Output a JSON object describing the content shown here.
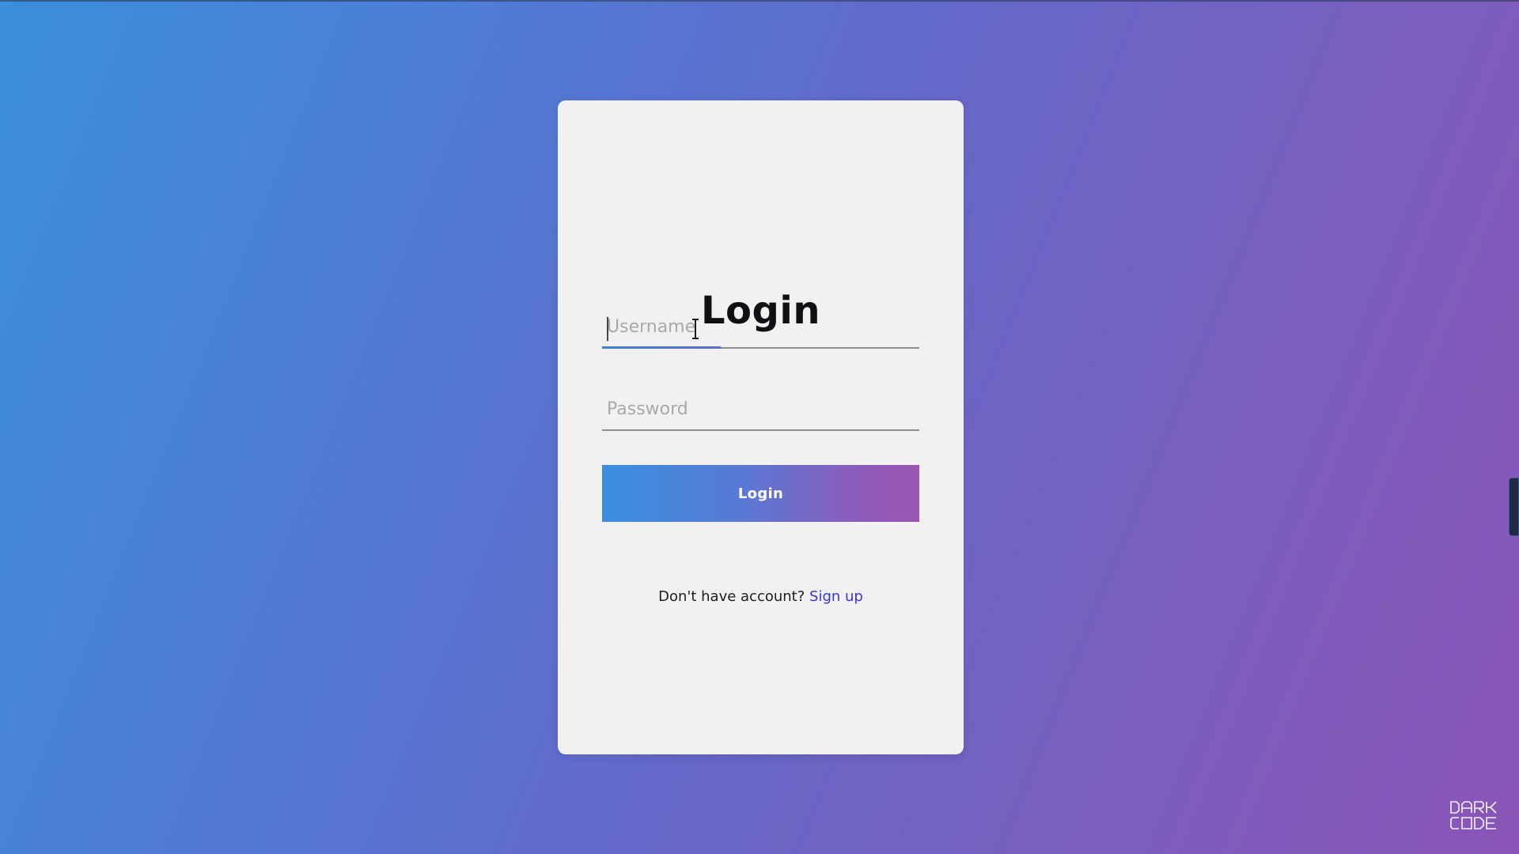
{
  "page": {
    "title": "Login"
  },
  "form": {
    "username_placeholder": "Username",
    "username_value": "",
    "password_placeholder": "Password",
    "password_value": "",
    "login_button_label": "Login",
    "focused_field": "username"
  },
  "footer": {
    "prompt_text": "Don't have account?",
    "signup_link_label": "Sign up"
  },
  "watermark": {
    "line1": "DARK",
    "line2": "CODE"
  },
  "theme": {
    "gradient_start": "#3a8edc",
    "gradient_end": "#8a55b8",
    "card_background": "#f1f1f2",
    "link_color": "#3b34d6"
  },
  "icons": {
    "cursor": "text-cursor-icon",
    "scroll": "scroll-handle"
  }
}
